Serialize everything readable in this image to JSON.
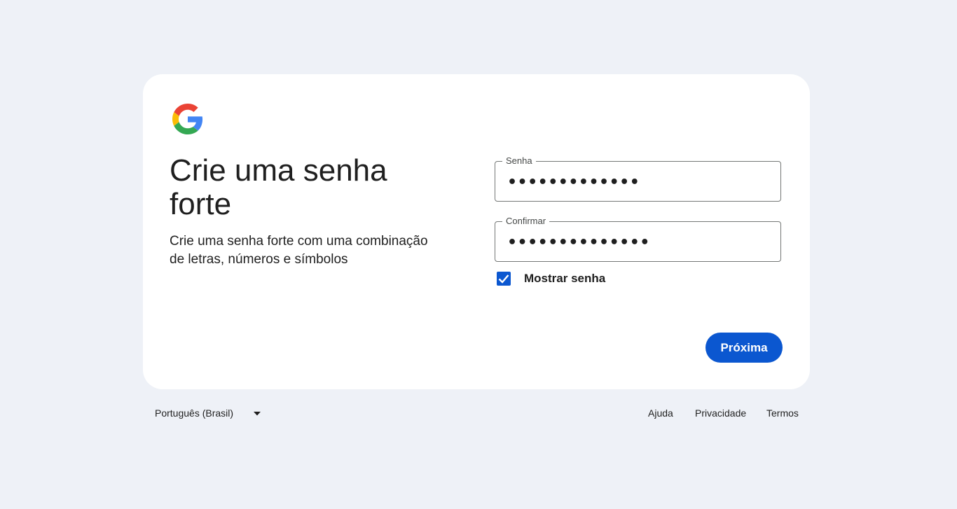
{
  "header": {
    "logo_icon": "google-g-logo",
    "title": "Crie uma senha forte",
    "subtitle": "Crie uma senha forte com uma combinação de letras, números e símbolos"
  },
  "form": {
    "password": {
      "label": "Senha",
      "value": "•••••••••••••"
    },
    "confirm": {
      "label": "Confirmar",
      "value": "••••••••••••••"
    },
    "show_password": {
      "label": "Mostrar senha",
      "checked": true
    },
    "next_label": "Próxima"
  },
  "footer": {
    "language": "Português (Brasil)",
    "links": {
      "help": "Ajuda",
      "privacy": "Privacidade",
      "terms": "Termos"
    }
  },
  "colors": {
    "background": "#eef1f7",
    "card": "#ffffff",
    "primary": "#0b57d0",
    "text": "#1f1f1f"
  }
}
